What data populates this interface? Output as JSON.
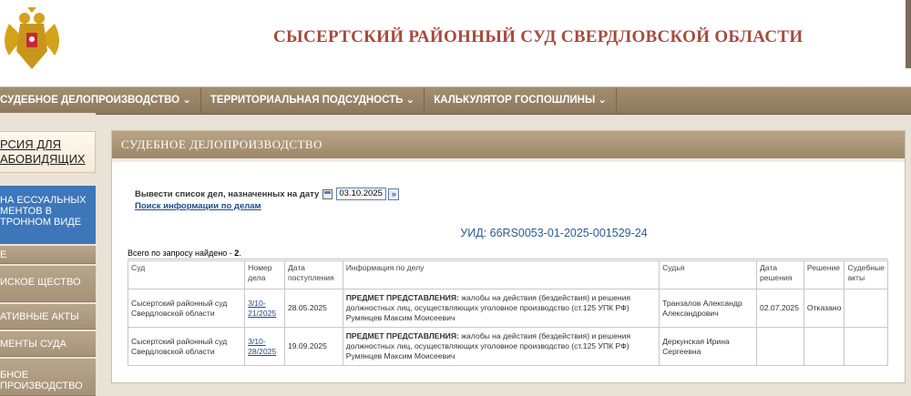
{
  "header": {
    "title": "СЫСЕРТСКИЙ РАЙОННЫЙ СУД СВЕРДЛОВСКОЙ ОБЛАСТИ",
    "emblem_icon": "coat-of-arms-icon"
  },
  "nav": {
    "items": [
      "СУДЕБНОЕ ДЕЛОПРОИЗВОДСТВО ⌄",
      "ТЕРРИТОРИАЛЬНАЯ ПОДСУДНОСТЬ ⌄",
      "КАЛЬКУЛЯТОР ГОСПОШЛИНЫ ⌄"
    ]
  },
  "sidebar": {
    "top_link": "РСИЯ ДЛЯ АБОВИДЯЩИХ",
    "blue_link": "НА ЕССУАЛЬНЫХ МЕНТОВ В ТРОННОМ ВИДЕ",
    "links": [
      "Е",
      "ИСКОЕ ЩЕСТВО",
      "АТИВНЫЕ АКТЫ",
      "МЕНТЫ СУДА",
      "БНОЕ ПРОИЗВОДСТВО"
    ]
  },
  "panel": {
    "title": "СУДЕБНОЕ ДЕЛОПРОИЗВОДСТВО",
    "date_label": "Вывести список дел, назначенных на дату",
    "date_value": "03.10.2025",
    "go_button": "»",
    "search_link": "Поиск информации по делам",
    "uid": "УИД: 66RS0053-01-2025-001529-24",
    "total_label": "Всего по запросу найдено - ",
    "total_count": "2",
    "total_suffix": "."
  },
  "table": {
    "headers": [
      "Суд",
      "Номер дела",
      "Дата поступления",
      "Информация по делу",
      "Судья",
      "Дата решения",
      "Решение",
      "Судебные акты"
    ],
    "rows": [
      {
        "court": "Сысертский районный суд Свердловской области",
        "case_number": "3/10-21/2025",
        "received": "28.05.2025",
        "info_label": "ПРЕДМЕТ ПРЕДСТАВЛЕНИЯ:",
        "info_text": "жалобы на действия (бездействия) и решения должностных лиц, осуществляющих уголовное производство (ст.125 УПК РФ)",
        "info_person": "Румянцев Максим Моисеевич",
        "judge": "Транзалов Александр Александрович",
        "decision_date": "02.07.2025",
        "decision": "Отказано",
        "acts": ""
      },
      {
        "court": "Сысертский районный суд Свердловской области",
        "case_number": "3/10-28/2025",
        "received": "19.09.2025",
        "info_label": "ПРЕДМЕТ ПРЕДСТАВЛЕНИЯ:",
        "info_text": "жалобы на действия (бездействия) и решения должностных лиц, осуществляющих уголовное производство (ст.125 УПК РФ)",
        "info_person": "Румянцев Максим Моисеевич",
        "judge": "Деркунская Ирина Сергеевна",
        "decision_date": "",
        "decision": "",
        "acts": ""
      }
    ]
  },
  "colors": {
    "title": "#a84a3c",
    "nav": "#8d785c",
    "link": "#1d4c8c",
    "accent_blue": "#3d77b9"
  }
}
